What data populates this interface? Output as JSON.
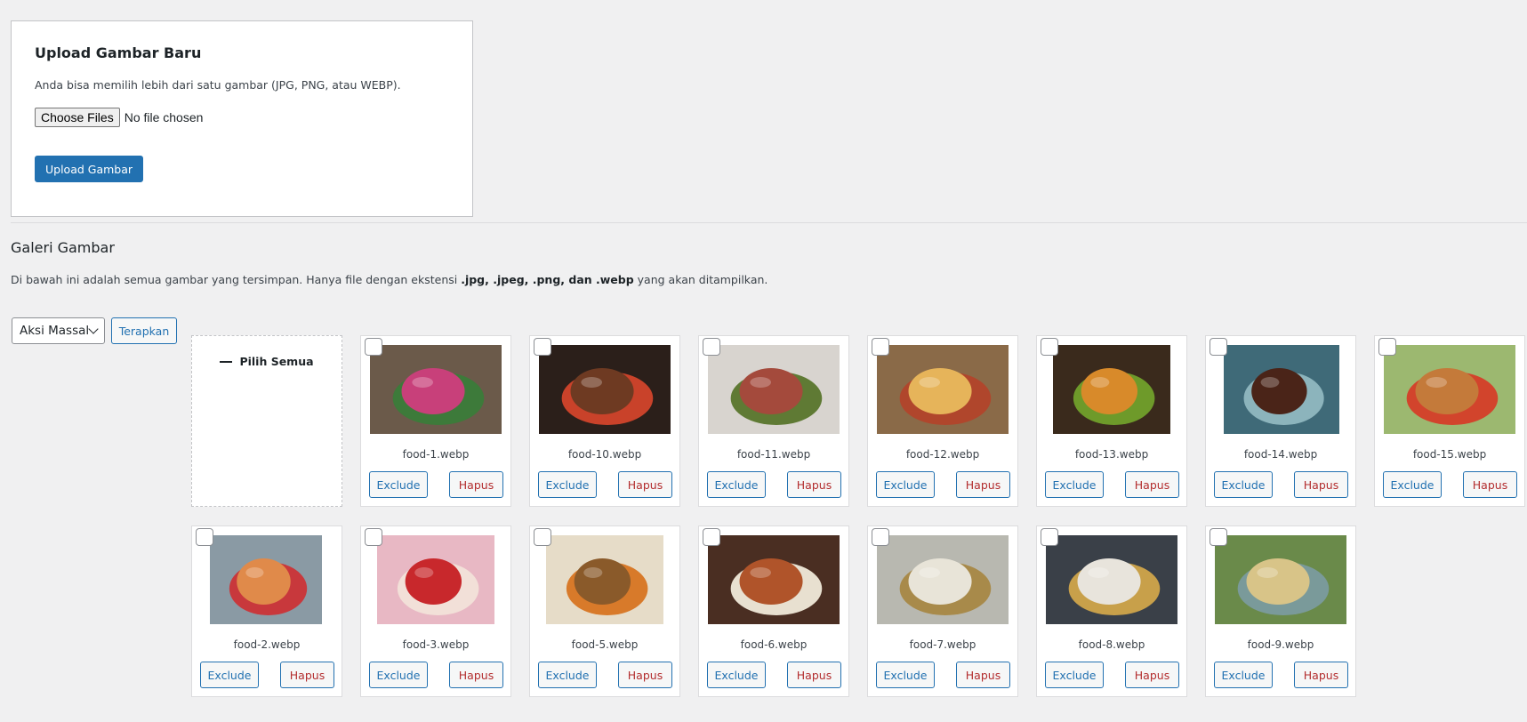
{
  "upload": {
    "title": "Upload Gambar Baru",
    "description": "Anda bisa memilih lebih dari satu gambar (JPG, PNG, atau WEBP).",
    "choose_label": "Choose Files",
    "file_status": "No file chosen",
    "submit_label": "Upload Gambar"
  },
  "gallery": {
    "title": "Galeri Gambar",
    "desc_prefix": "Di bawah ini adalah semua gambar yang tersimpan. Hanya file dengan ekstensi ",
    "desc_bold": ".jpg, .jpeg, .png, dan .webp",
    "desc_suffix": " yang akan ditampilkan.",
    "bulk_action_label": "Aksi Massal",
    "apply_label": "Terapkan",
    "select_all_label": "Pilih Semua",
    "exclude_label": "Exclude",
    "delete_label": "Hapus",
    "items": [
      {
        "filename": "food-1.webp",
        "palette": [
          "#6b5a4a",
          "#c8407a",
          "#3d7a3a"
        ]
      },
      {
        "filename": "food-10.webp",
        "palette": [
          "#2b1f1a",
          "#6e3a22",
          "#c9422a"
        ]
      },
      {
        "filename": "food-11.webp",
        "palette": [
          "#d8d4cf",
          "#a44a3c",
          "#5f7a34"
        ]
      },
      {
        "filename": "food-12.webp",
        "palette": [
          "#8a6a48",
          "#e6b45a",
          "#b0462c"
        ]
      },
      {
        "filename": "food-13.webp",
        "palette": [
          "#3a2a1c",
          "#d88a2a",
          "#6e9a2a"
        ]
      },
      {
        "filename": "food-14.webp",
        "palette": [
          "#3f6a78",
          "#4a2418",
          "#8cb4bc"
        ]
      },
      {
        "filename": "food-15.webp",
        "palette": [
          "#9cb870",
          "#c47a3a",
          "#d2442c"
        ]
      },
      {
        "filename": "food-2.webp",
        "palette": [
          "#8a9aa4",
          "#e08a4a",
          "#c8383c"
        ]
      },
      {
        "filename": "food-3.webp",
        "palette": [
          "#e8b8c4",
          "#c8282c",
          "#f2e0d8"
        ]
      },
      {
        "filename": "food-5.webp",
        "palette": [
          "#e6dcc8",
          "#8a5a2a",
          "#d87a2a"
        ]
      },
      {
        "filename": "food-6.webp",
        "palette": [
          "#4a2e22",
          "#b0542a",
          "#e8e0d0"
        ]
      },
      {
        "filename": "food-7.webp",
        "palette": [
          "#b8b8b0",
          "#e8e4d8",
          "#a88a4a"
        ]
      },
      {
        "filename": "food-8.webp",
        "palette": [
          "#3a4048",
          "#e8e4dc",
          "#c8a04a"
        ]
      },
      {
        "filename": "food-9.webp",
        "palette": [
          "#6a8a4a",
          "#d8c488",
          "#7a9a9a"
        ]
      }
    ]
  }
}
